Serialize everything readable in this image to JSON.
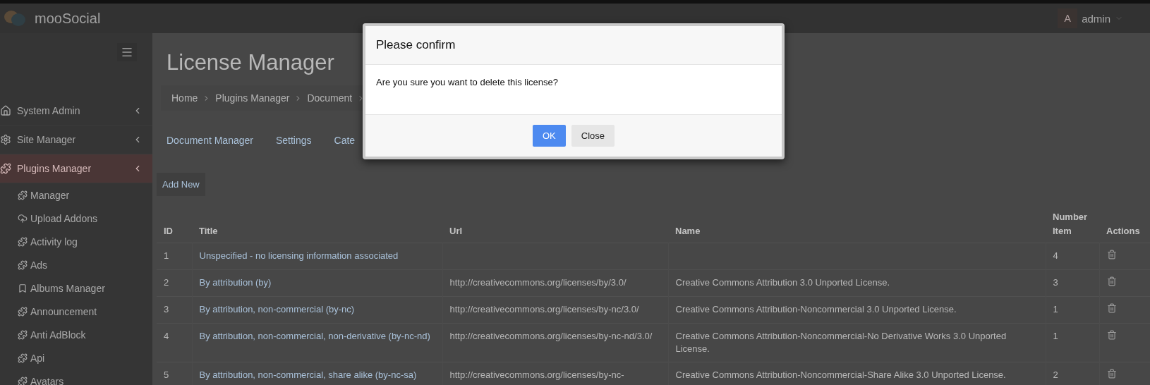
{
  "topbar": {
    "logo": "mooSocial",
    "user": {
      "initial": "A",
      "name": "admin"
    }
  },
  "sidebar": {
    "items": [
      {
        "label": "System Admin",
        "selected": false
      },
      {
        "label": "Site Manager",
        "selected": false
      },
      {
        "label": "Plugins Manager",
        "selected": true,
        "children": [
          {
            "label": "Manager"
          },
          {
            "label": "Upload Addons"
          },
          {
            "label": "Activity log"
          },
          {
            "label": "Ads"
          },
          {
            "label": "Albums Manager"
          },
          {
            "label": "Announcement"
          },
          {
            "label": "Anti AdBlock"
          },
          {
            "label": "Api"
          },
          {
            "label": "Avatars"
          }
        ]
      }
    ]
  },
  "page": {
    "title": "License Manager",
    "breadcrumb": [
      "Home",
      "Plugins Manager",
      "Document"
    ],
    "tabs": [
      "Document Manager",
      "Settings",
      "Cate"
    ],
    "add_button": "Add New",
    "table": {
      "columns": [
        "ID",
        "Title",
        "Url",
        "Name",
        "Number Item",
        "Actions"
      ],
      "rows": [
        {
          "id": "1",
          "title": "Unspecified - no licensing information associated",
          "url": "",
          "name": "",
          "count": "4"
        },
        {
          "id": "2",
          "title": "By attribution (by)",
          "url": "http://creativecommons.org/licenses/by/3.0/",
          "name": "Creative Commons Attribution 3.0 Unported License.",
          "count": "3"
        },
        {
          "id": "3",
          "title": "By attribution, non-commercial (by-nc)",
          "url": "http://creativecommons.org/licenses/by-nc/3.0/",
          "name": "Creative Commons Attribution-Noncommercial 3.0 Unported License.",
          "count": "1"
        },
        {
          "id": "4",
          "title": "By attribution, non-commercial, non-derivative (by-nc-nd)",
          "url": "http://creativecommons.org/licenses/by-nc-nd/3.0/",
          "name": "Creative Commons Attribution-Noncommercial-No Derivative Works 3.0 Unported License.",
          "count": "1"
        },
        {
          "id": "5",
          "title": "By attribution, non-commercial, share alike (by-nc-sa)",
          "url": "http://creativecommons.org/licenses/by-nc-",
          "name": "Creative Commons Attribution-Noncommercial-Share Alike 3.0 Unported License.",
          "count": "2"
        }
      ]
    }
  },
  "modal": {
    "title": "Please confirm",
    "message": "Are you sure you want to delete this license?",
    "buttons": [
      {
        "label": "OK",
        "kind": "primary"
      },
      {
        "label": "Close",
        "kind": "default"
      }
    ]
  }
}
